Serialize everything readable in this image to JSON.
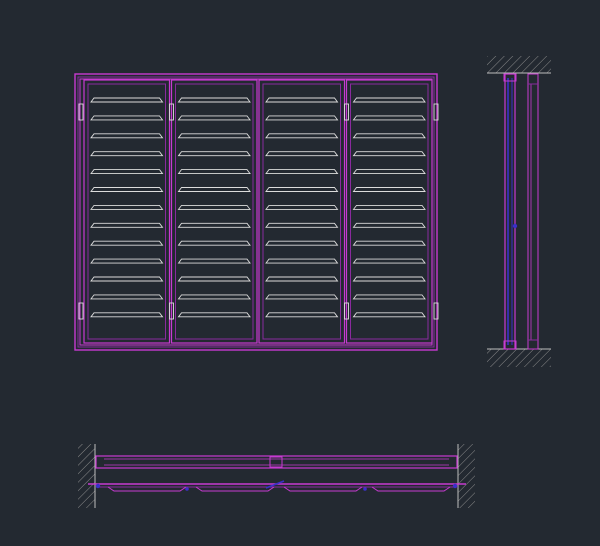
{
  "drawing": {
    "background": "#232931",
    "colors": {
      "frame": "#c73ad1",
      "frame_dark": "#8a2a9e",
      "slat": "#dcdcdc",
      "section": "#3b2fc9",
      "hatch": "#8c8c8c",
      "ground": "#bdbdbd"
    },
    "elevation": {
      "panels": 4,
      "slats_per_panel": 13,
      "hinge_icon": "hinge-icon"
    },
    "side_section": {
      "label": "side-section"
    },
    "plan_section": {
      "label": "plan-section"
    }
  }
}
